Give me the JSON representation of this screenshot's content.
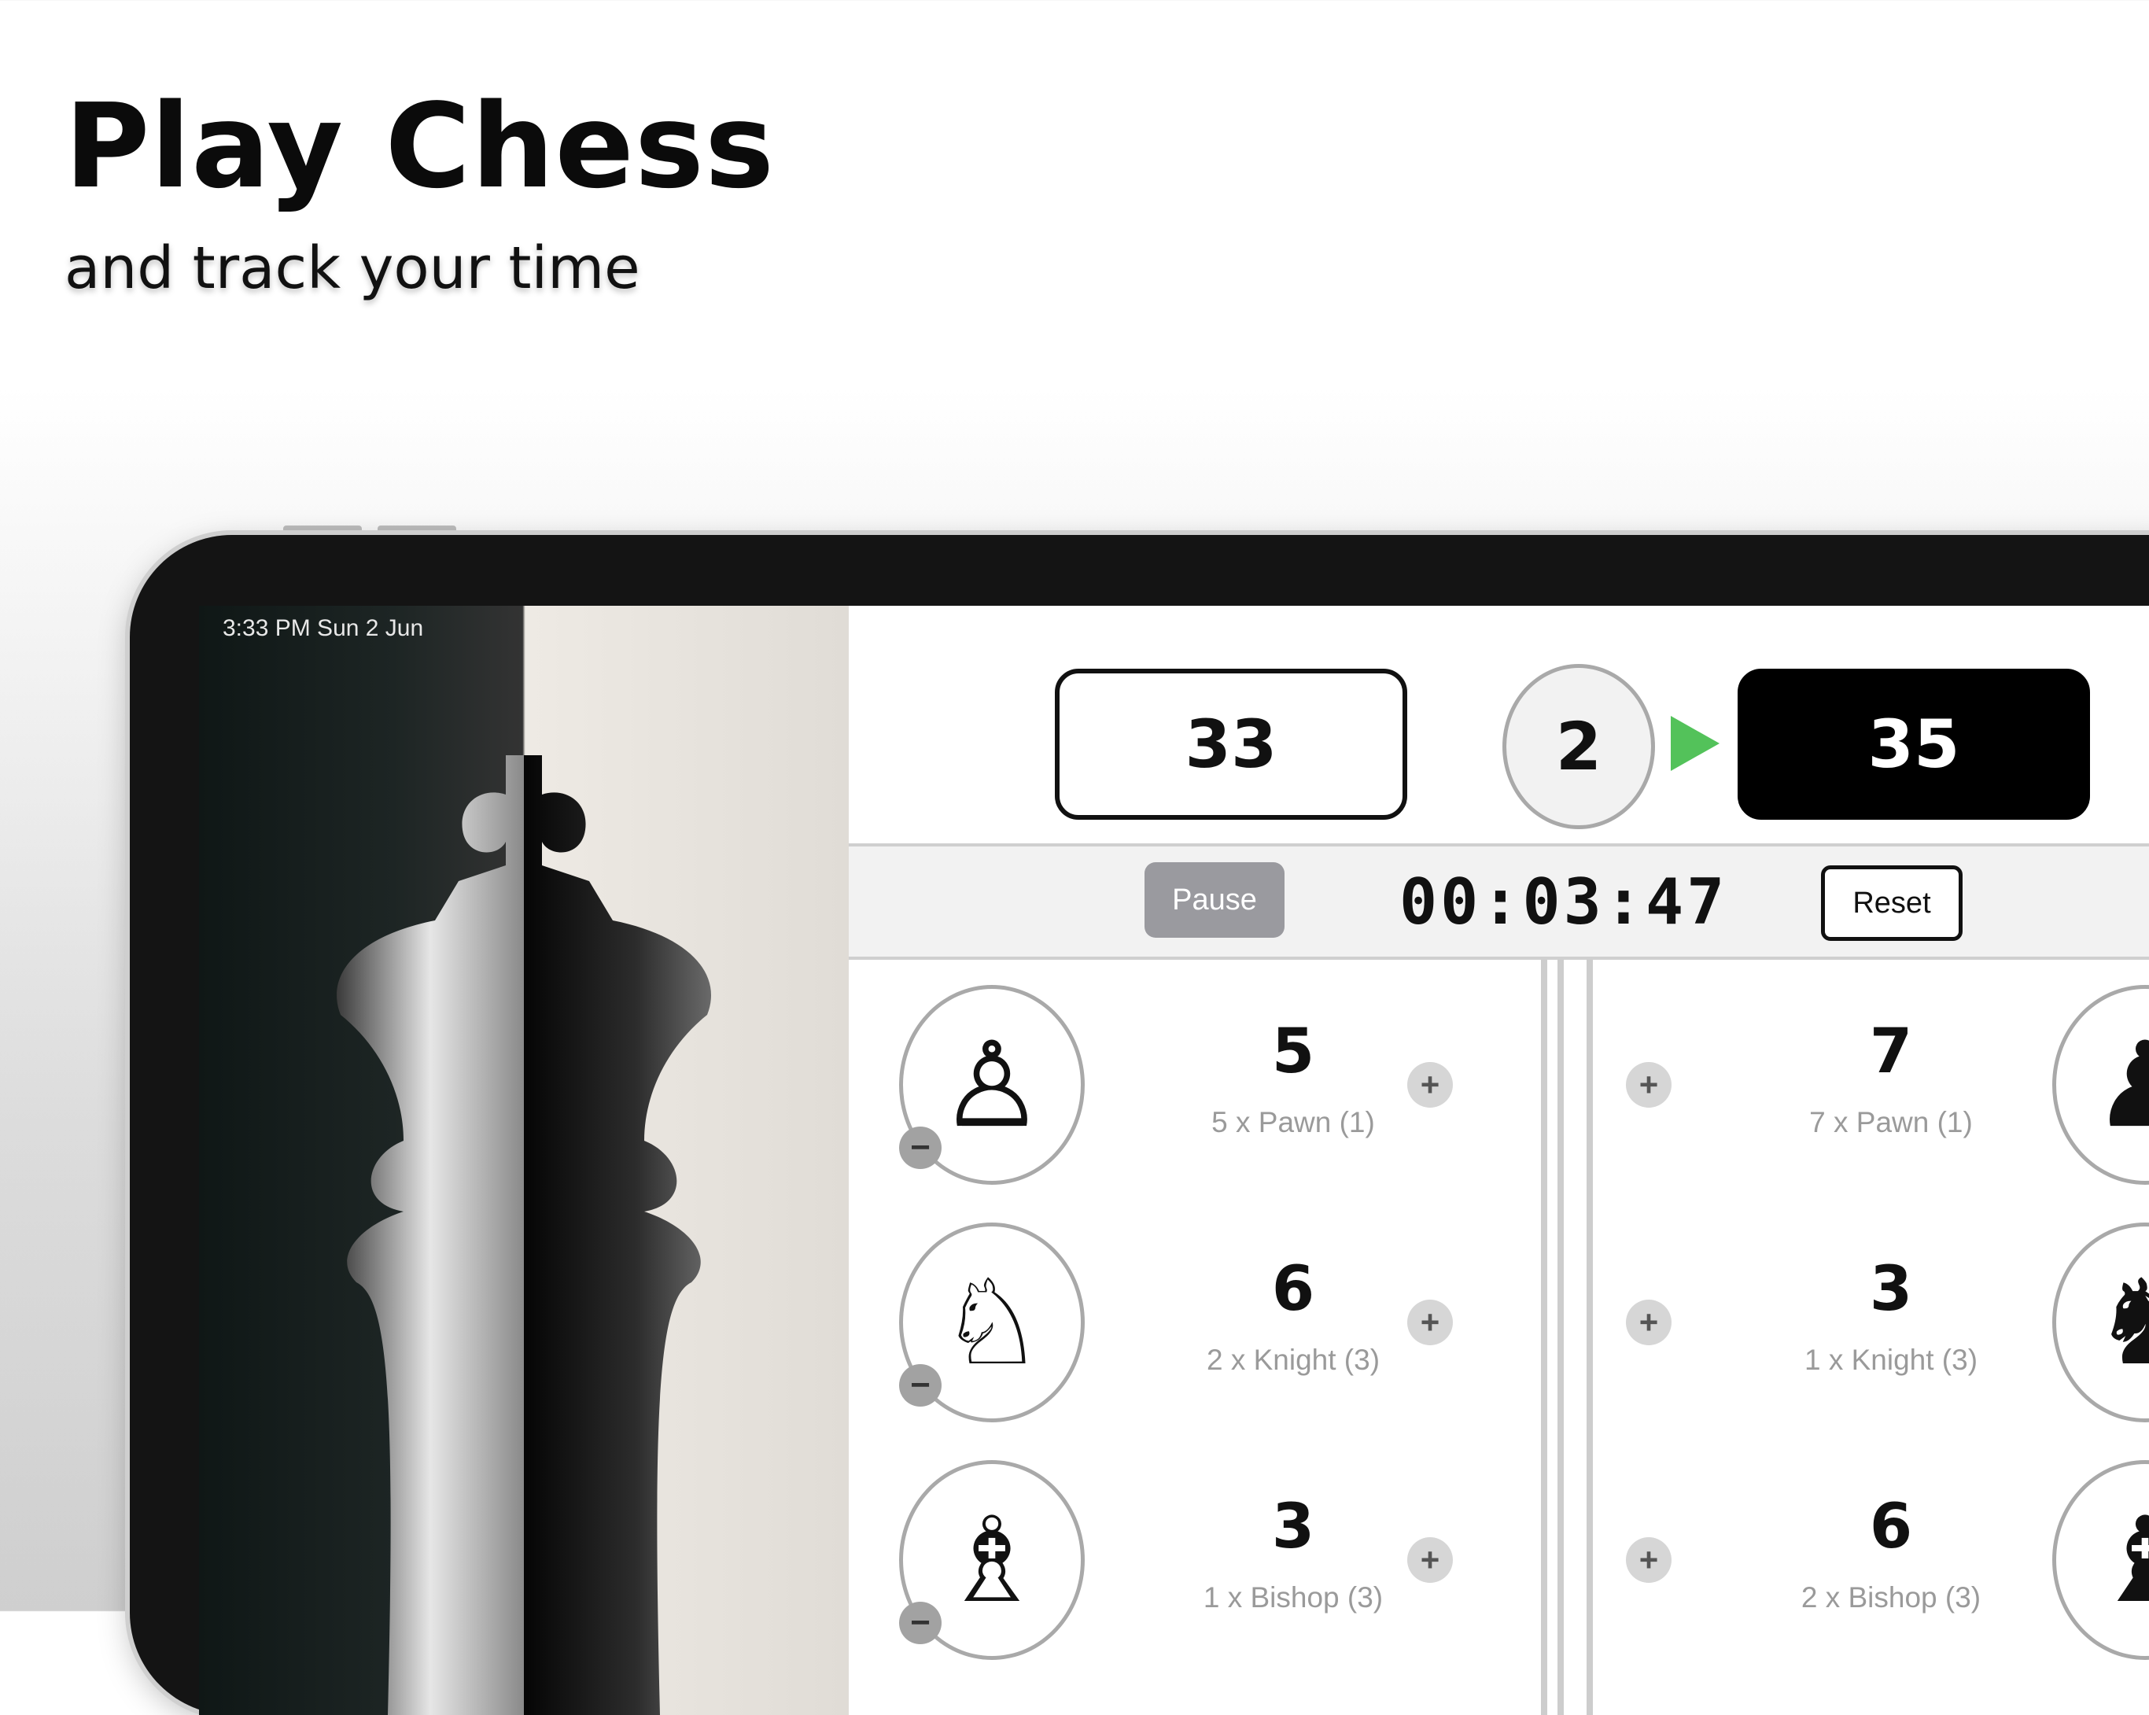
{
  "headline": "Play Chess",
  "subline": "and track your time",
  "status_bar": {
    "time_date": "3:33 PM   Sun 2 Jun",
    "wifi_icon": "wifi-icon"
  },
  "scoreboard": {
    "white_score": "33",
    "round": "2",
    "black_score": "35",
    "turn_indicator_color": "#53c25a"
  },
  "controls": {
    "pause_label": "Pause",
    "timer": "00:03:47",
    "reset_label": "Reset"
  },
  "pieces": [
    {
      "icon": "pawn-icon",
      "white_glyph": "♙",
      "black_glyph": "♟",
      "white_count": "5",
      "white_detail": "5 x Pawn (1)",
      "black_count": "7",
      "black_detail": "7 x Pawn (1)"
    },
    {
      "icon": "knight-icon",
      "white_glyph": "♘",
      "black_glyph": "♞",
      "white_count": "6",
      "white_detail": "2 x Knight (3)",
      "black_count": "3",
      "black_detail": "1 x Knight (3)"
    },
    {
      "icon": "bishop-icon",
      "white_glyph": "♗",
      "black_glyph": "♝",
      "white_count": "3",
      "white_detail": "1 x Bishop (3)",
      "black_count": "6",
      "black_detail": "2 x Bishop (3)"
    }
  ],
  "glyphs": {
    "plus": "+",
    "minus": "−"
  }
}
